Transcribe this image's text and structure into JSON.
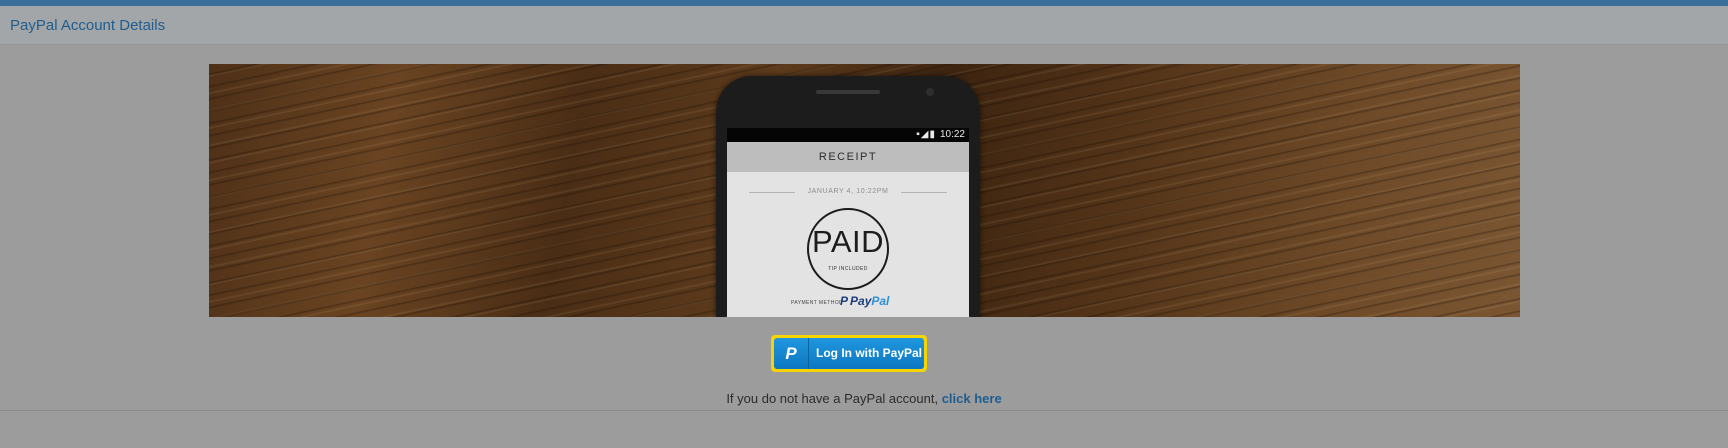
{
  "header": {
    "title": "PayPal Account Details"
  },
  "banner": {
    "phone": {
      "status_time": "10:22",
      "status_icons": "▪◢▮",
      "receipt_title": "RECEIPT",
      "date": "JANUARY 4, 10:22PM",
      "paid_label": "PAID",
      "tip_label": "TIP INCLUDED",
      "payment_method_label": "PAYMENT METHOD",
      "brand_pay": "Pay",
      "brand_pal": "Pal",
      "brand_glyph": "P"
    }
  },
  "login": {
    "icon_glyph": "P",
    "button_label": "Log In with PayPal"
  },
  "signup": {
    "prefix": "If you do not have a PayPal account, ",
    "link": "click here"
  },
  "colors": {
    "accent": "#1f5d8f",
    "button_blue": "#0d77c2",
    "focus_outline": "#f6d400",
    "overlay_gray": "#9c9c9c"
  }
}
